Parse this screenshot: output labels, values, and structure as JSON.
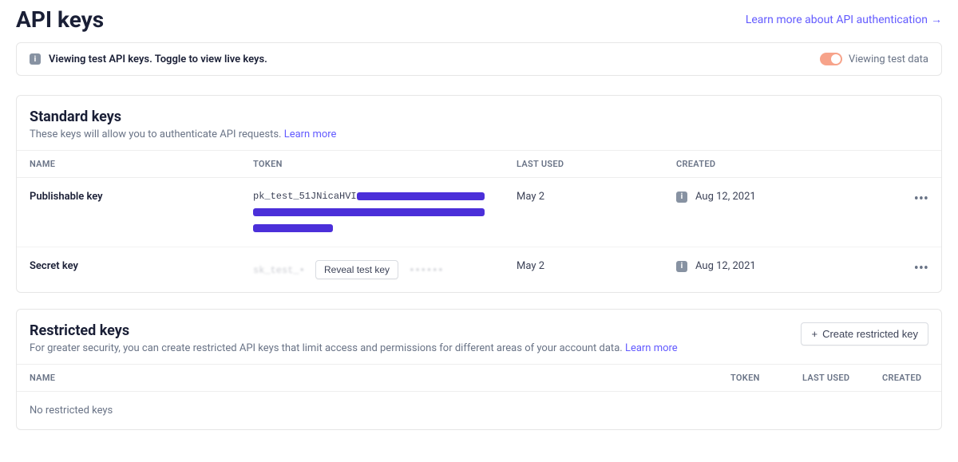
{
  "header": {
    "title": "API keys",
    "learn_more_label": "Learn more about API authentication"
  },
  "banner": {
    "message": "Viewing test API keys. Toggle to view live keys.",
    "toggle_label": "Viewing test data",
    "toggle_on": true
  },
  "standard": {
    "title": "Standard keys",
    "description": "These keys will allow you to authenticate API requests.",
    "learn_more": "Learn more",
    "columns": {
      "name": "NAME",
      "token": "TOKEN",
      "last_used": "LAST USED",
      "created": "CREATED"
    },
    "rows": [
      {
        "name": "Publishable key",
        "token_prefix": "pk_test_51JNicaHVI",
        "last_used": "May 2",
        "created": "Aug 12, 2021"
      },
      {
        "name": "Secret key",
        "reveal_label": "Reveal test key",
        "last_used": "May 2",
        "created": "Aug 12, 2021"
      }
    ]
  },
  "restricted": {
    "title": "Restricted keys",
    "description": "For greater security, you can create restricted API keys that limit access and permissions for different areas of your account data.",
    "learn_more": "Learn more",
    "create_button": "Create restricted key",
    "columns": {
      "name": "NAME",
      "token": "TOKEN",
      "last_used": "LAST USED",
      "created": "CREATED"
    },
    "empty_text": "No restricted keys"
  }
}
